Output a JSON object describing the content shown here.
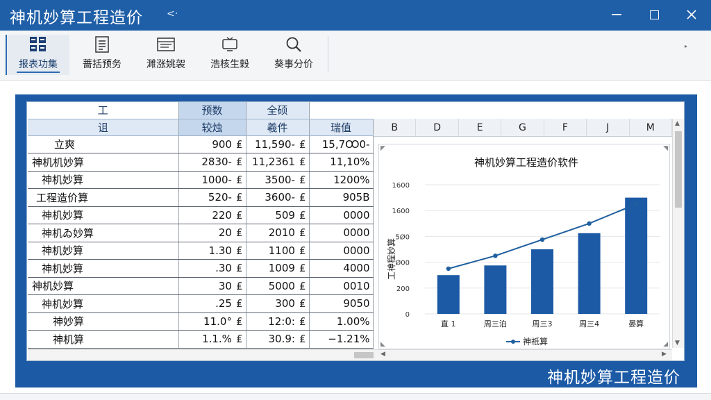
{
  "window": {
    "title": "神机妙算工程造价",
    "nav_arrows": "<·"
  },
  "ribbon": {
    "items": [
      {
        "label": "报表功集",
        "icon": "grid-report-icon"
      },
      {
        "label": "蔷括预务",
        "icon": "document-list-icon"
      },
      {
        "label": "濉涨姚袈",
        "icon": "table-sheet-icon"
      },
      {
        "label": "浩核生榖",
        "icon": "monitor-icon"
      },
      {
        "label": "葵事分价",
        "icon": "search-icon"
      }
    ]
  },
  "table": {
    "header_row1": [
      "工",
      "预数",
      "全硕"
    ],
    "header_row2": [
      "诅",
      "较烛",
      "羲件",
      "瑞值"
    ],
    "rows": [
      {
        "name": "立爽",
        "v1": "900",
        "v2": "11,590-",
        "v3": "15,7Ꝏ0-"
      },
      {
        "name": "神机机妙算",
        "v1": "2830-",
        "v2": "11,2361",
        "v3": "11,10%"
      },
      {
        "name": "神机妙算",
        "v1": "1000-",
        "v2": "3500-",
        "v3": "1200%"
      },
      {
        "name": "工程造价算",
        "v1": "520-",
        "v2": "3600-",
        "v3": "905B"
      },
      {
        "name": "神机妙算",
        "v1": "220",
        "v2": "509",
        "v3": "0000"
      },
      {
        "name": "神机ゐ妙算",
        "v1": "20",
        "v2": "2010",
        "v3": "0000"
      },
      {
        "name": "神机妙算",
        "v1": "1.30",
        "v2": "1100",
        "v3": "0000"
      },
      {
        "name": "神机妙算",
        "v1": ".30",
        "v2": "1009",
        "v3": "4000"
      },
      {
        "name": "神机妙算",
        "v1": "30",
        "v2": "5000",
        "v3": "0010"
      },
      {
        "name": "神机妙算",
        "v1": ".25",
        "v2": "300",
        "v3": "9050"
      },
      {
        "name": "神妙算",
        "v1": "11.0°",
        "v2": "12:0:",
        "v3": "1.00%"
      },
      {
        "name": "神机算",
        "v1": "1.1.%",
        "v2": "30.9:",
        "v3": "−1.21%"
      }
    ],
    "currency_symbol": "₤"
  },
  "sheet_columns": [
    "B",
    "D",
    "E",
    "G",
    "F",
    "J",
    "M"
  ],
  "chart_data": {
    "type": "bar",
    "title": "神机妙算工程造价软件",
    "ylabel": "工神程妙算",
    "yticks": [
      "0",
      "200",
      "Ø00",
      "5Ø0",
      "1600",
      "1600"
    ],
    "ylim": [
      0,
      2000
    ],
    "categories": [
      "直 1",
      "周三泊",
      "周三3",
      "周三4",
      "晏算"
    ],
    "bar_values": [
      600,
      750,
      1000,
      1250,
      1800
    ],
    "series": [
      {
        "name": "神祇算",
        "values": [
          700,
          900,
          1150,
          1400,
          1700
        ]
      }
    ],
    "legend": "bottom",
    "bar_color": "#1c5aa6",
    "line_color": "#1f5f9e"
  },
  "footer": {
    "watermark": "神机妙算工程造价"
  },
  "colors": {
    "accent": "#1f5fa8",
    "frame": "#1c5aa6"
  }
}
